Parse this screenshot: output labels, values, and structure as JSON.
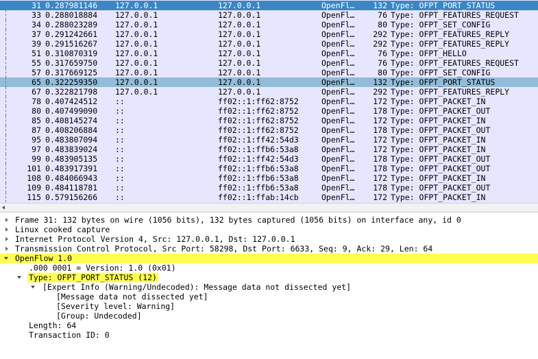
{
  "packet_list": {
    "rows": [
      {
        "no": "31",
        "time": "0.287981146",
        "src": "127.0.0.1",
        "dst": "127.0.0.1",
        "proto": "OpenFl…",
        "len": "132",
        "info": "Type: OFPT_PORT_STATUS"
      },
      {
        "no": "33",
        "time": "0.288018884",
        "src": "127.0.0.1",
        "dst": "127.0.0.1",
        "proto": "OpenFl…",
        "len": "76",
        "info": "Type: OFPT_FEATURES_REQUEST"
      },
      {
        "no": "34",
        "time": "0.288023289",
        "src": "127.0.0.1",
        "dst": "127.0.0.1",
        "proto": "OpenFl…",
        "len": "80",
        "info": "Type: OFPT_SET_CONFIG"
      },
      {
        "no": "37",
        "time": "0.291242661",
        "src": "127.0.0.1",
        "dst": "127.0.0.1",
        "proto": "OpenFl…",
        "len": "292",
        "info": "Type: OFPT_FEATURES_REPLY"
      },
      {
        "no": "39",
        "time": "0.291516267",
        "src": "127.0.0.1",
        "dst": "127.0.0.1",
        "proto": "OpenFl…",
        "len": "292",
        "info": "Type: OFPT_FEATURES_REPLY"
      },
      {
        "no": "51",
        "time": "0.310870319",
        "src": "127.0.0.1",
        "dst": "127.0.0.1",
        "proto": "OpenFl…",
        "len": "76",
        "info": "Type: OFPT_HELLO"
      },
      {
        "no": "55",
        "time": "0.317659750",
        "src": "127.0.0.1",
        "dst": "127.0.0.1",
        "proto": "OpenFl…",
        "len": "76",
        "info": "Type: OFPT_FEATURES_REQUEST"
      },
      {
        "no": "57",
        "time": "0.317669125",
        "src": "127.0.0.1",
        "dst": "127.0.0.1",
        "proto": "OpenFl…",
        "len": "80",
        "info": "Type: OFPT_SET_CONFIG"
      },
      {
        "no": "65",
        "time": "0.322259350",
        "src": "127.0.0.1",
        "dst": "127.0.0.1",
        "proto": "OpenFl…",
        "len": "132",
        "info": "Type: OFPT_PORT_STATUS"
      },
      {
        "no": "67",
        "time": "0.322821798",
        "src": "127.0.0.1",
        "dst": "127.0.0.1",
        "proto": "OpenFl…",
        "len": "292",
        "info": "Type: OFPT_FEATURES_REPLY"
      },
      {
        "no": "78",
        "time": "0.407424512",
        "src": "::",
        "dst": "ff02::1:ff62:8752",
        "proto": "OpenFl…",
        "len": "172",
        "info": "Type: OFPT_PACKET_IN"
      },
      {
        "no": "80",
        "time": "0.407499090",
        "src": "::",
        "dst": "ff02::1:ff62:8752",
        "proto": "OpenFl…",
        "len": "178",
        "info": "Type: OFPT_PACKET_OUT"
      },
      {
        "no": "85",
        "time": "0.408145274",
        "src": "::",
        "dst": "ff02::1:ff62:8752",
        "proto": "OpenFl…",
        "len": "172",
        "info": "Type: OFPT_PACKET_IN"
      },
      {
        "no": "87",
        "time": "0.408206884",
        "src": "::",
        "dst": "ff02::1:ff62:8752",
        "proto": "OpenFl…",
        "len": "178",
        "info": "Type: OFPT_PACKET_OUT"
      },
      {
        "no": "95",
        "time": "0.483807094",
        "src": "::",
        "dst": "ff02::1:ff42:54d3",
        "proto": "OpenFl…",
        "len": "172",
        "info": "Type: OFPT_PACKET_IN"
      },
      {
        "no": "97",
        "time": "0.483839024",
        "src": "::",
        "dst": "ff02::1:ffb6:53a8",
        "proto": "OpenFl…",
        "len": "172",
        "info": "Type: OFPT_PACKET_IN"
      },
      {
        "no": "99",
        "time": "0.483905135",
        "src": "::",
        "dst": "ff02::1:ff42:54d3",
        "proto": "OpenFl…",
        "len": "178",
        "info": "Type: OFPT_PACKET_OUT"
      },
      {
        "no": "101",
        "time": "0.483917391",
        "src": "::",
        "dst": "ff02::1:ffb6:53a8",
        "proto": "OpenFl…",
        "len": "178",
        "info": "Type: OFPT_PACKET_OUT"
      },
      {
        "no": "108",
        "time": "0.484066943",
        "src": "::",
        "dst": "ff02::1:ffb6:53a8",
        "proto": "OpenFl…",
        "len": "172",
        "info": "Type: OFPT_PACKET_IN"
      },
      {
        "no": "109",
        "time": "0.484118781",
        "src": "::",
        "dst": "ff02::1:ffb6:53a8",
        "proto": "OpenFl…",
        "len": "178",
        "info": "Type: OFPT_PACKET_OUT"
      },
      {
        "no": "115",
        "time": "0.579156266",
        "src": "::",
        "dst": "ff02::1:ffab:14cb",
        "proto": "OpenFl…",
        "len": "172",
        "info": "Type: OFPT_PACKET_IN"
      }
    ]
  },
  "details": {
    "frame": "Frame 31: 132 bytes on wire (1056 bits), 132 bytes captured (1056 bits) on interface any, id 0",
    "linux_cooked": "Linux cooked capture",
    "ipv4": "Internet Protocol Version 4, Src: 127.0.0.1, Dst: 127.0.0.1",
    "tcp": "Transmission Control Protocol, Src Port: 58298, Dst Port: 6633, Seq: 9, Ack: 29, Len: 64",
    "openflow": "OpenFlow 1.0",
    "version": ".000 0001 = Version: 1.0 (0x01)",
    "type": "Type: OFPT_PORT_STATUS (12)",
    "expert": "[Expert Info (Warning/Undecoded): Message data not dissected yet]",
    "expert_msg": "[Message data not dissected yet]",
    "severity": "[Severity level: Warning]",
    "group": "[Group: Undecoded]",
    "length": "Length: 64",
    "xid": "Transaction ID: 0"
  },
  "colors": {
    "list_bg": "#e7e6ff",
    "selected": "#3b86c5",
    "related": "#92bcd9",
    "highlight": "#ffff50"
  }
}
